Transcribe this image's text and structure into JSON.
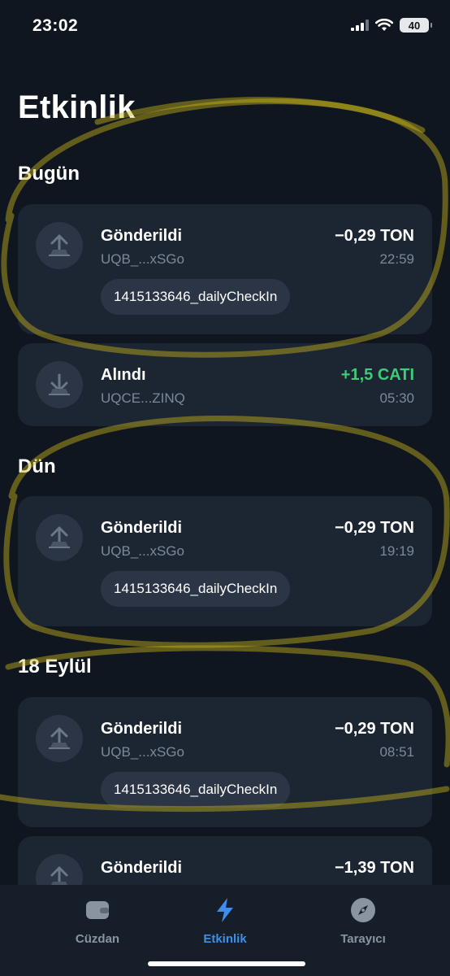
{
  "status_bar": {
    "time": "23:02",
    "battery": "40"
  },
  "page": {
    "title": "Etkinlik"
  },
  "sections": [
    {
      "title": "Bugün"
    },
    {
      "title": "Dün"
    },
    {
      "title": "18 Eylül"
    }
  ],
  "transactions": [
    {
      "type": "Gönderildi",
      "address": "UQB_...xSGo",
      "amount": "−0,29 TON",
      "time": "22:59",
      "comment": "1415133646_dailyCheckIn",
      "direction": "out"
    },
    {
      "type": "Alındı",
      "address": "UQCE...ZINQ",
      "amount": "+1,5 CATI",
      "time": "05:30",
      "direction": "in"
    },
    {
      "type": "Gönderildi",
      "address": "UQB_...xSGo",
      "amount": "−0,29 TON",
      "time": "19:19",
      "comment": "1415133646_dailyCheckIn",
      "direction": "out"
    },
    {
      "type": "Gönderildi",
      "address": "UQB_...xSGo",
      "amount": "−0,29 TON",
      "time": "08:51",
      "comment": "1415133646_dailyCheckIn",
      "direction": "out"
    },
    {
      "type": "Gönderildi",
      "amount": "−1,39 TON",
      "direction": "out"
    }
  ],
  "tab_bar": {
    "tabs": [
      {
        "label": "Cüzdan",
        "icon": "wallet-icon"
      },
      {
        "label": "Etkinlik",
        "icon": "lightning-icon",
        "active": true
      },
      {
        "label": "Tarayıcı",
        "icon": "compass-icon"
      }
    ]
  },
  "colors": {
    "background": "#10161f",
    "card": "#1c2532",
    "incoming": "#3fcb77",
    "accent": "#3d8fe8",
    "highlight": "#c8b418"
  }
}
